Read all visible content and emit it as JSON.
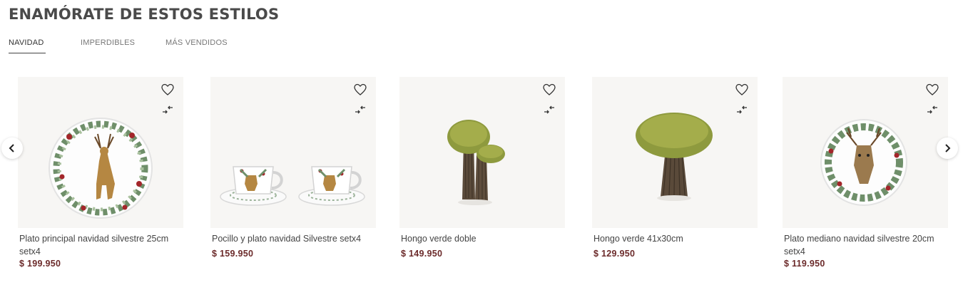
{
  "section": {
    "title": "ENAMÓRATE DE ESTOS ESTILOS"
  },
  "tabs": [
    {
      "label": "NAVIDAD",
      "active": true
    },
    {
      "label": "IMPERDIBLES",
      "active": false
    },
    {
      "label": "MÁS VENDIDOS",
      "active": false
    }
  ],
  "carousel": {
    "prev_icon": "chevron-left-icon",
    "next_icon": "chevron-right-icon"
  },
  "products": [
    {
      "name": "Plato principal navidad silvestre 25cm setx4",
      "price": "$ 199.950",
      "image": "dinner-plate-deer-wreath"
    },
    {
      "name": "Pocillo y plato navidad Silvestre setx4",
      "price": "$ 159.950",
      "image": "cups-and-saucers-deer"
    },
    {
      "name": "Hongo verde doble",
      "price": "$ 149.950",
      "image": "double-moss-mushroom"
    },
    {
      "name": "Hongo verde 41x30cm",
      "price": "$ 129.950",
      "image": "single-moss-mushroom"
    },
    {
      "name": "Plato mediano navidad silvestre 20cm setx4",
      "price": "$ 119.950",
      "image": "medium-plate-deer"
    }
  ],
  "icons": {
    "wishlist": "heart-icon",
    "compare": "compare-arrows-icon"
  },
  "colors": {
    "price": "#6b2a2a",
    "title": "#4a4a4a",
    "image_bg": "#f7f6f4"
  }
}
